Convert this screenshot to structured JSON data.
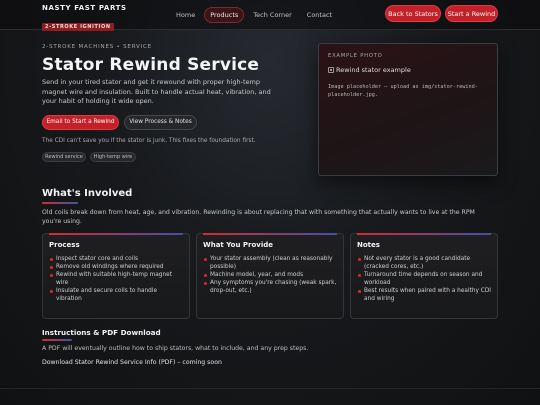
{
  "brand": {
    "name": "NASTY FAST PARTS",
    "tagline": "2-STROKE IGNITION"
  },
  "nav": {
    "links": [
      {
        "label": "Home",
        "active": false
      },
      {
        "label": "Products",
        "active": true
      },
      {
        "label": "Tech Corner",
        "active": false
      },
      {
        "label": "Contact",
        "active": false
      }
    ],
    "back_button": "Back to Stators",
    "start_button": "Start a Rewind"
  },
  "hero": {
    "eyebrow": "2-STROKE MACHINES • SERVICE",
    "title": "Stator Rewind Service",
    "lead": "Send in your tired stator and get it rewound with proper high-temp magnet wire and insulation. Built to handle actual heat, vibration, and your habit of holding it wide open.",
    "primary_button": "Email to Start a Rewind",
    "secondary_button": "View Process & Notes",
    "note": "The CDI can't save you if the stator is junk. This fixes the foundation first.",
    "chips": [
      "Rewind service",
      "High-temp wire"
    ]
  },
  "photo": {
    "label": "EXAMPLE PHOTO",
    "alt": "Rewind stator example",
    "caption": "Image placeholder – upload as img/stator-rewind-placeholder.jpg."
  },
  "involved": {
    "title": "What's Involved",
    "desc": "Old coils break down from heat, age, and vibration. Rewinding is about replacing that with something that actually wants to live at the RPM you're using."
  },
  "cards": [
    {
      "title": "Process",
      "items": [
        "Inspect stator core and coils",
        "Remove old windings where required",
        "Rewind with suitable high-temp magnet wire",
        "Insulate and secure coils to handle vibration"
      ]
    },
    {
      "title": "What You Provide",
      "items": [
        "Your stator assembly (clean as reasonably possible)",
        "Machine model, year, and mods",
        "Any symptoms you're chasing (weak spark, drop-out, etc.)"
      ]
    },
    {
      "title": "Notes",
      "items": [
        "Not every stator is a good candidate (cracked cores, etc.)",
        "Turnaround time depends on season and workload",
        "Best results when paired with a healthy CDI and wiring"
      ]
    }
  ],
  "instructions": {
    "title": "Instructions & PDF Download",
    "desc": "A PDF will eventually outline how to ship stators, what to include, and any prep steps.",
    "link": "Download Stator Rewind Service Info (PDF) – coming soon"
  },
  "colors": {
    "accent": "#c4202a",
    "background": "#17191c",
    "link_blue": "#4150a8"
  }
}
